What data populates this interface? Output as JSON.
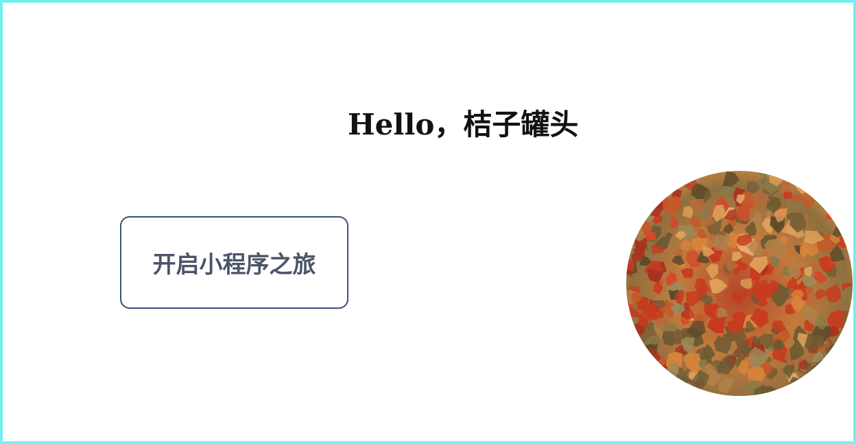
{
  "header": {
    "greeting": "Hello，桔子罐头"
  },
  "actions": {
    "start_label": "开启小程序之旅"
  },
  "avatar": {
    "description_colors": {
      "primary": "#c8782c",
      "secondary": "#b33a1e",
      "tertiary": "#7a6a3a"
    }
  },
  "theme": {
    "frame_border": "#74f0f2",
    "button_border": "#3c4f78",
    "button_text": "#4a5569",
    "greeting_text": "#111111"
  }
}
